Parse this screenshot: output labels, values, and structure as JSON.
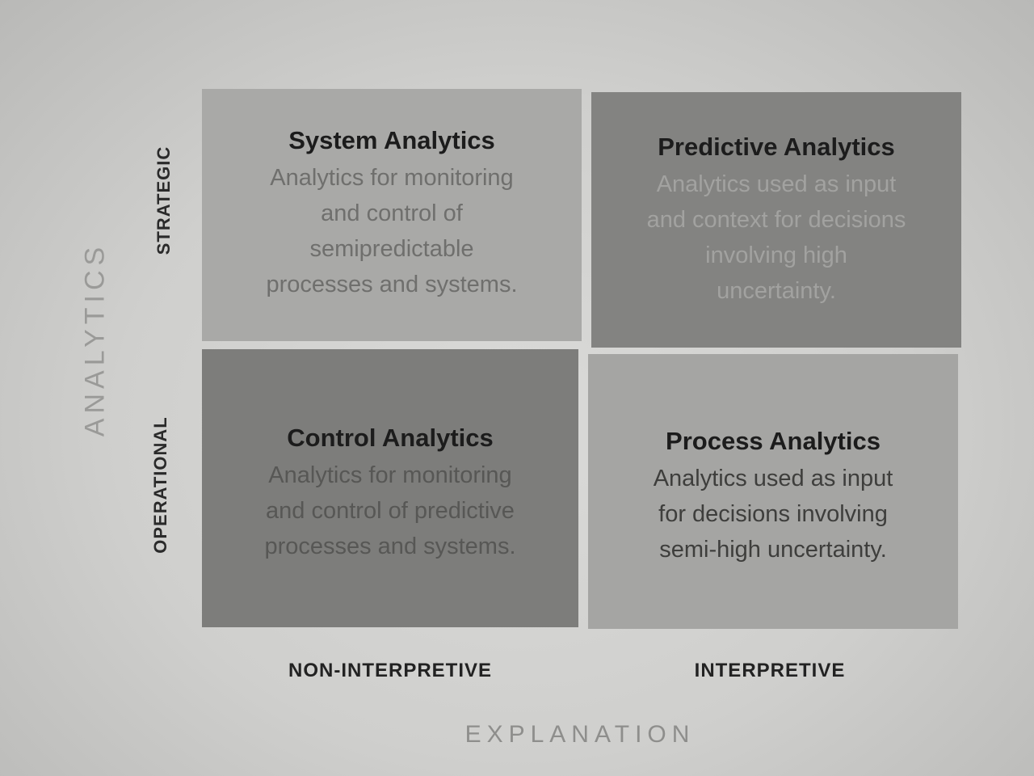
{
  "axes": {
    "y_title": "ANALYTICS",
    "x_title": "EXPLANATION",
    "rows": [
      "STRATEGIC",
      "OPERATIONAL"
    ],
    "columns": [
      "NON-INTERPRETIVE",
      "INTERPRETIVE"
    ]
  },
  "quadrants": {
    "system": {
      "title": "System Analytics",
      "description": "Analytics for monitoring\nand control of\nsemipredictable\nprocesses and systems."
    },
    "predictive": {
      "title": "Predictive Analytics",
      "description": "Analytics used as input\nand context for decisions\ninvolving high\nuncertainty."
    },
    "control": {
      "title": "Control Analytics",
      "description": "Analytics for monitoring\nand control of predictive\nprocesses and systems."
    },
    "process": {
      "title": "Process Analytics",
      "description": "Analytics used as input\nfor decisions involving\nsemi-high uncertainty."
    }
  }
}
